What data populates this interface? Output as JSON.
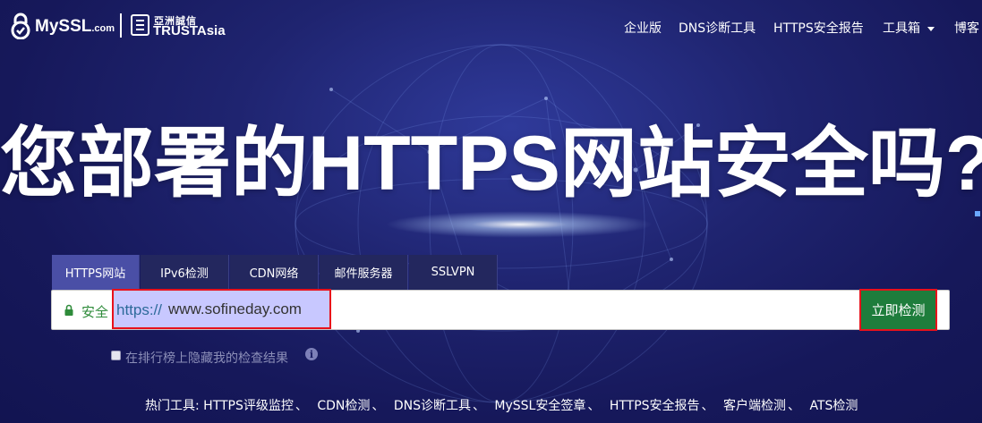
{
  "header": {
    "logo_text": "MySSL",
    "logo_suffix": ".com",
    "partner_cn": "亞洲誠信",
    "partner_en": "TRUSTAsia",
    "nav": [
      {
        "label": "企业版"
      },
      {
        "label": "DNS诊断工具"
      },
      {
        "label": "HTTPS安全报告"
      },
      {
        "label": "工具箱",
        "icon": "caret-down-icon"
      },
      {
        "label": "博客"
      }
    ]
  },
  "hero": {
    "headline": "您部署的HTTPS网站安全吗?"
  },
  "tabs": [
    {
      "label": "HTTPS网站",
      "active": true
    },
    {
      "label": "IPv6检测"
    },
    {
      "label": "CDN网络"
    },
    {
      "label": "邮件服务器"
    },
    {
      "label": "SSLVPN"
    }
  ],
  "search": {
    "secure_label": "安全",
    "prefix": "https://",
    "value": "www.sofineday.com",
    "button": "立即检测"
  },
  "options": {
    "hide_label": "在排行榜上隐藏我的检查结果",
    "checked": false
  },
  "hot_tools": {
    "label": "热门工具:",
    "separator": "、",
    "items": [
      "HTTPS评级监控",
      "CDN检测",
      "DNS诊断工具",
      "MySSL安全签章",
      "HTTPS安全报告",
      "客户端检测",
      "ATS检测"
    ]
  },
  "colors": {
    "background": "#1c2068",
    "button": "#1e7d3c",
    "highlight_border": "#e8111b",
    "secure": "#2e8b3a"
  }
}
